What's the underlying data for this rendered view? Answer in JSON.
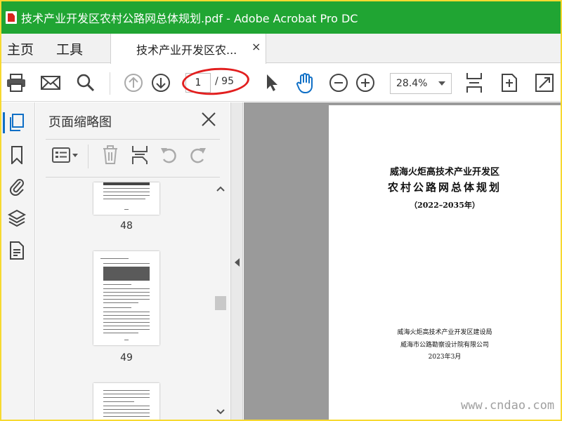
{
  "window": {
    "title": "技术产业开发区农村公路网总体规划.pdf - Adobe Acrobat Pro DC"
  },
  "tabs": {
    "home": "主页",
    "tools": "工具",
    "document": "技术产业开发区农...",
    "close": "×"
  },
  "toolbar": {
    "current_page": "1",
    "total_pages": "/ 95",
    "zoom": "28.4%"
  },
  "thumbnails_panel": {
    "title": "页面缩略图",
    "pages": [
      {
        "label": "48"
      },
      {
        "label": "49"
      }
    ]
  },
  "document": {
    "line1": "威海火炬高技术产业开发区",
    "line2": "农村公路网总体规划",
    "line3": "（2022–2035年）",
    "org1": "威海火炬高技术产业开发区建设局",
    "org2": "威海市公路勘察设计院有限公司",
    "date": "2023年3月"
  },
  "watermark": {
    "site": "www.cndao.com"
  },
  "colors": {
    "titlebar": "#20a533",
    "annotation": "#e21f1f",
    "accent": "#0f6fc6",
    "frame": "#f7d930"
  }
}
